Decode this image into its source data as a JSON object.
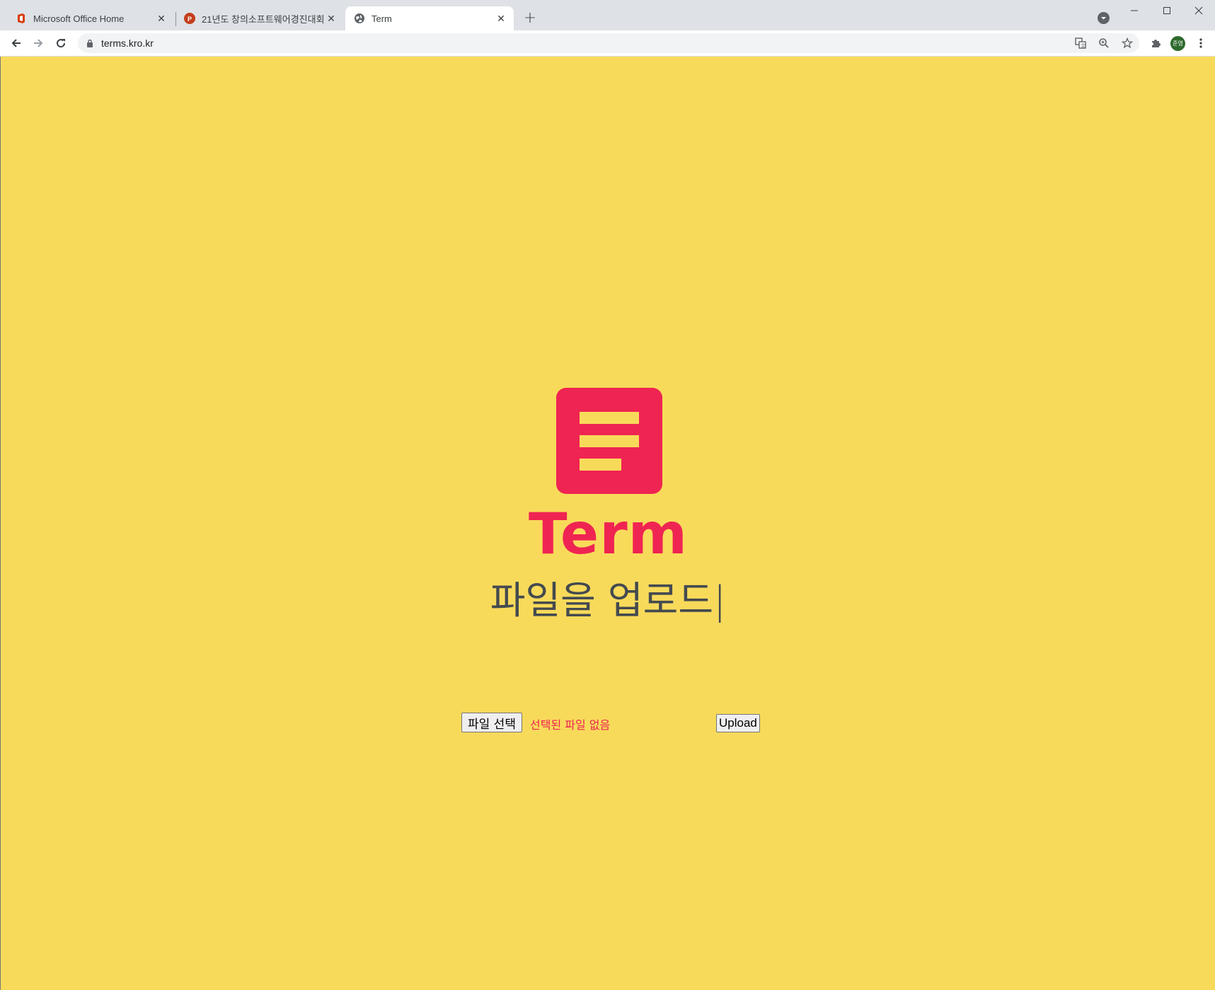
{
  "browser": {
    "tabs": [
      {
        "title": "Microsoft Office Home",
        "favicon": "office-icon",
        "active": false
      },
      {
        "title": "21년도 창의소프트웨어경진대회",
        "favicon": "powerpoint-icon",
        "active": false
      },
      {
        "title": "Term",
        "favicon": "globe-icon",
        "active": true
      }
    ],
    "url": "terms.kro.kr",
    "profile_initials": "준영"
  },
  "page": {
    "brand": "Term",
    "subtitle": "파일을 업로드",
    "caret": "|",
    "file_button_label": "파일 선택",
    "file_status": "선택된 파일 없음",
    "upload_label": "Upload"
  },
  "colors": {
    "background": "#f8da5b",
    "accent": "#ef2452",
    "subtitle": "#444a4f"
  }
}
